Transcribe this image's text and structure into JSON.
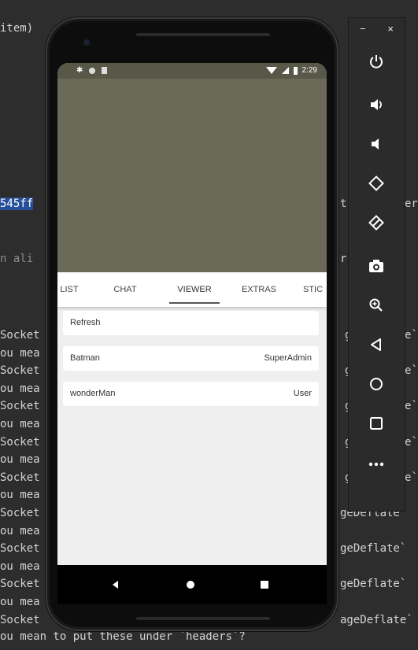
{
  "editor": {
    "line_top": "item)",
    "hash_fragment": "545ff",
    "hash_right": "t",
    "err_right": "er",
    "warn_left": "n ali",
    "warn_right": "r",
    "socket_lines": [
      {
        "left": "Socket",
        "right": "g",
        "tail": "e`"
      },
      {
        "left": "ou mea",
        "right": "",
        "tail": ""
      },
      {
        "left": "Socket",
        "right": "g",
        "tail": "e`"
      },
      {
        "left": "ou mea",
        "right": "",
        "tail": ""
      },
      {
        "left": "Socket",
        "right": "g",
        "tail": "e`"
      },
      {
        "left": "ou mea",
        "right": "",
        "tail": ""
      },
      {
        "left": "Socket",
        "right": "g",
        "tail": "e`"
      },
      {
        "left": "ou mea",
        "right": "",
        "tail": ""
      },
      {
        "left": "Socket",
        "right": "g",
        "tail": "e`"
      },
      {
        "left": "ou mea",
        "right": "",
        "tail": ""
      },
      {
        "left": "Socket",
        "right": "geDeflate`",
        "tail": ""
      },
      {
        "left": "ou mea",
        "right": "",
        "tail": ""
      },
      {
        "left": "Socket",
        "right": "geDeflate`",
        "tail": ""
      },
      {
        "left": "ou mea",
        "right": "",
        "tail": ""
      },
      {
        "left": "Socket",
        "right": "geDeflate`",
        "tail": ""
      },
      {
        "left": "ou mea",
        "right": "",
        "tail": ""
      },
      {
        "left": "Socket",
        "right": "ageDeflate`",
        "tail": ""
      }
    ],
    "last_line": "ou mean to put these under `headers`?"
  },
  "statusbar": {
    "time": "2:29"
  },
  "tabs": [
    "LIST",
    "CHAT",
    "VIEWER",
    "EXTRAS",
    "STIC"
  ],
  "active_tab": "VIEWER",
  "refresh_label": "Refresh",
  "viewers": [
    {
      "name": "Batman",
      "role": "SuperAdmin"
    },
    {
      "name": "wonderMan",
      "role": "User"
    }
  ],
  "panel": {
    "minimize": "−",
    "close": "×",
    "buttons": [
      "power-icon",
      "volume-up-icon",
      "volume-down-icon",
      "rotate-left-icon",
      "rotate-right-icon",
      "camera-icon",
      "zoom-icon",
      "back-icon",
      "home-icon",
      "overview-icon",
      "more-icon"
    ]
  },
  "colors": {
    "video_bg": "#6b6a59",
    "status_bg": "#585849",
    "screen_bg": "#efefef",
    "panel_bg": "#2b2b2b"
  }
}
